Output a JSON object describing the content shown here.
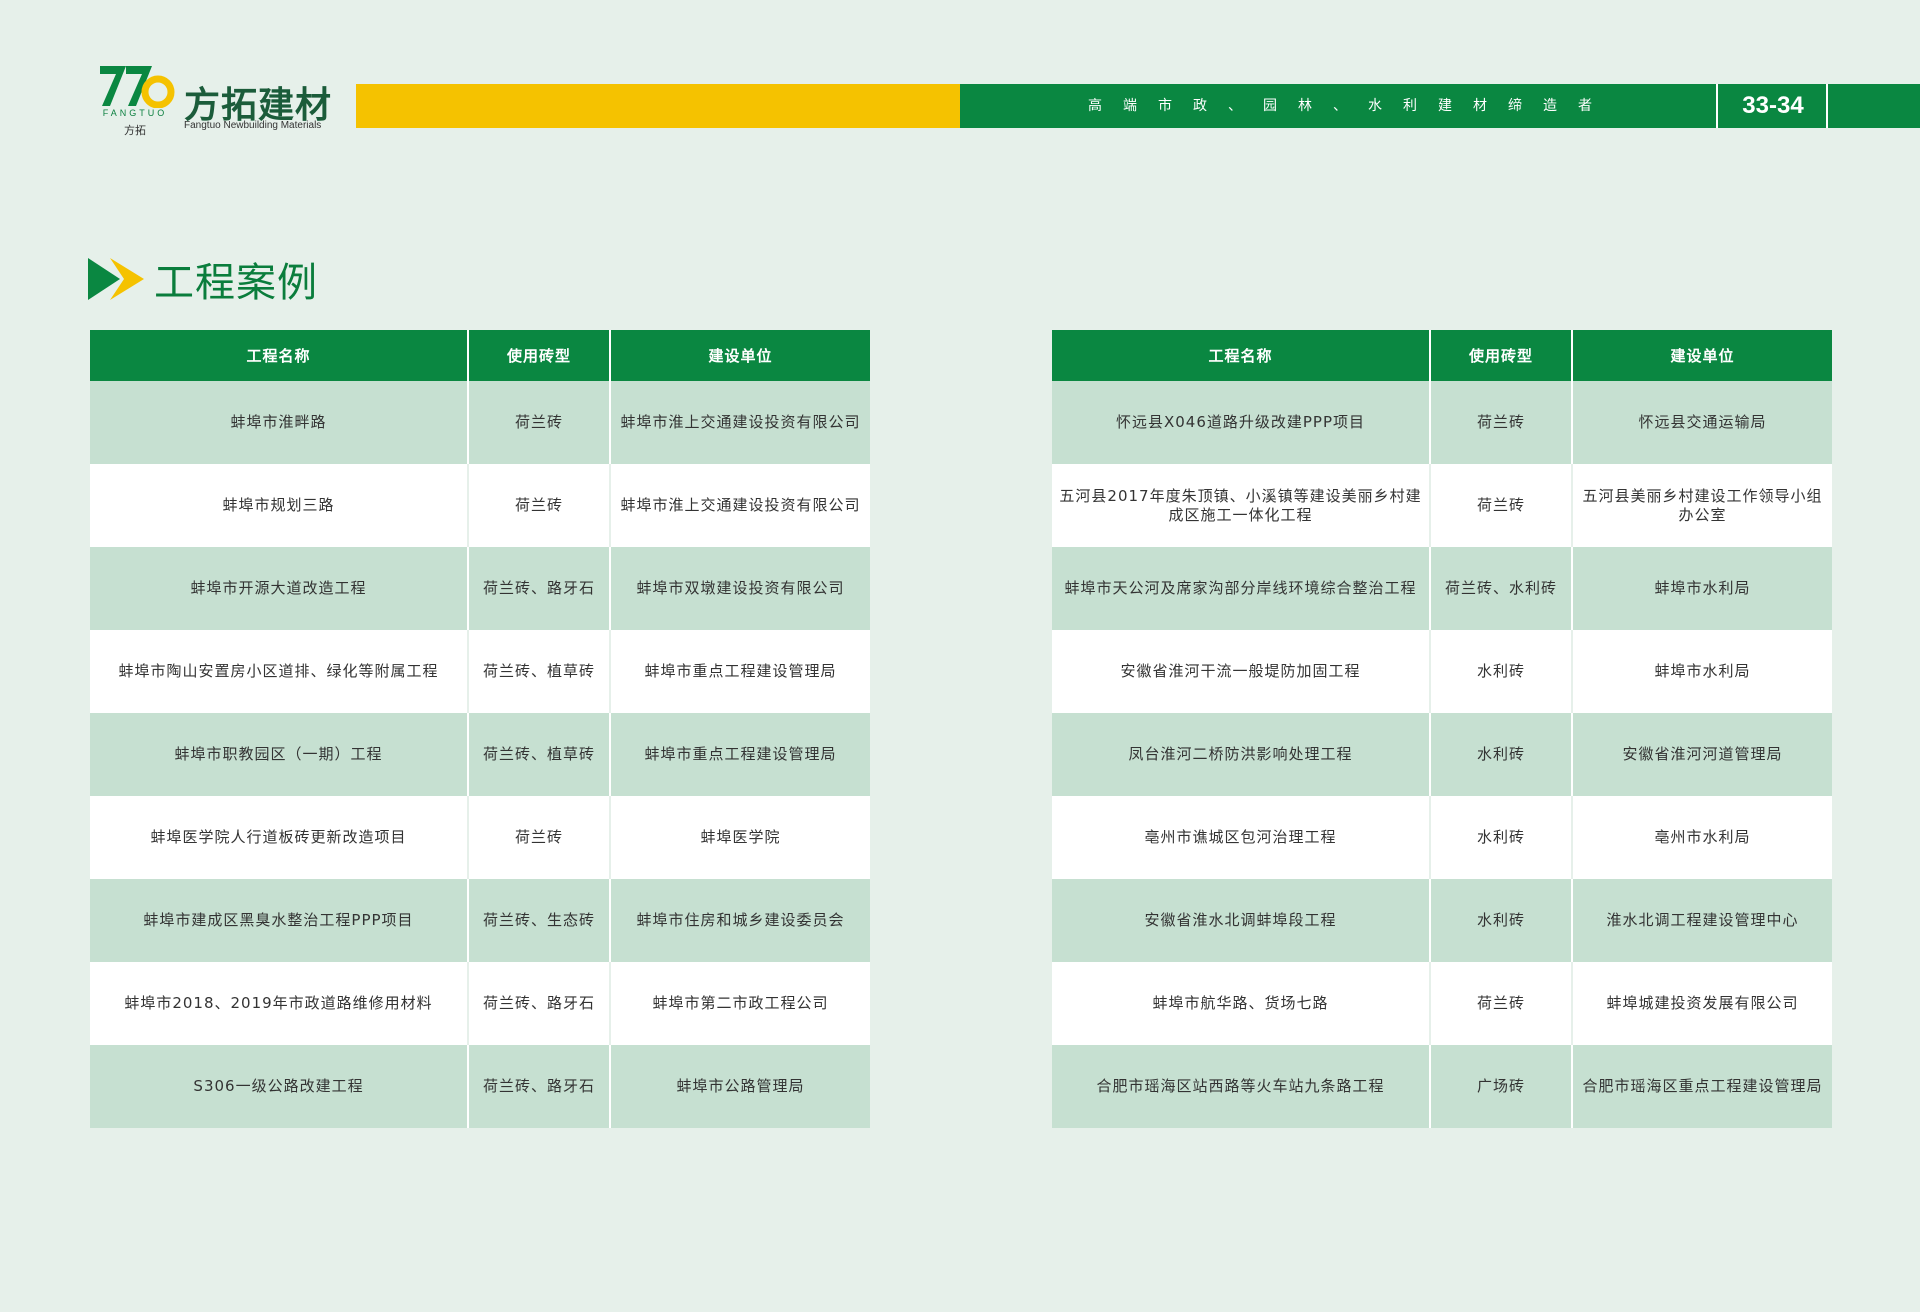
{
  "brand": {
    "mark_sub": "FANGTUO",
    "mark_cn": "方拓",
    "name_cn": "方拓建材",
    "name_en": "Fangtuo Newbuilding Materials"
  },
  "header": {
    "slogan": "高端市政、园林、水利建材缔造者",
    "page_number": "33-34"
  },
  "section": {
    "title": "工程案例"
  },
  "colors": {
    "green": "#0a8741",
    "yellow": "#f5c200",
    "row_tint": "#c6e0d1"
  },
  "table_left": {
    "headers": [
      "工程名称",
      "使用砖型",
      "建设单位"
    ],
    "rows": [
      [
        "蚌埠市淮畔路",
        "荷兰砖",
        "蚌埠市淮上交通建设投资有限公司"
      ],
      [
        "蚌埠市规划三路",
        "荷兰砖",
        "蚌埠市淮上交通建设投资有限公司"
      ],
      [
        "蚌埠市开源大道改造工程",
        "荷兰砖、路牙石",
        "蚌埠市双墩建设投资有限公司"
      ],
      [
        "蚌埠市陶山安置房小区道排、绿化等附属工程",
        "荷兰砖、植草砖",
        "蚌埠市重点工程建设管理局"
      ],
      [
        "蚌埠市职教园区（一期）工程",
        "荷兰砖、植草砖",
        "蚌埠市重点工程建设管理局"
      ],
      [
        "蚌埠医学院人行道板砖更新改造项目",
        "荷兰砖",
        "蚌埠医学院"
      ],
      [
        "蚌埠市建成区黑臭水整治工程PPP项目",
        "荷兰砖、生态砖",
        "蚌埠市住房和城乡建设委员会"
      ],
      [
        "蚌埠市2018、2019年市政道路维修用材料",
        "荷兰砖、路牙石",
        "蚌埠市第二市政工程公司"
      ],
      [
        "S306一级公路改建工程",
        "荷兰砖、路牙石",
        "蚌埠市公路管理局"
      ]
    ]
  },
  "table_right": {
    "headers": [
      "工程名称",
      "使用砖型",
      "建设单位"
    ],
    "rows": [
      [
        "怀远县X046道路升级改建PPP项目",
        "荷兰砖",
        "怀远县交通运输局"
      ],
      [
        "五河县2017年度朱顶镇、小溪镇等建设美丽乡村建成区施工一体化工程",
        "荷兰砖",
        "五河县美丽乡村建设工作领导小组办公室"
      ],
      [
        "蚌埠市天公河及席家沟部分岸线环境综合整治工程",
        "荷兰砖、水利砖",
        "蚌埠市水利局"
      ],
      [
        "安徽省淮河干流一般堤防加固工程",
        "水利砖",
        "蚌埠市水利局"
      ],
      [
        "凤台淮河二桥防洪影响处理工程",
        "水利砖",
        "安徽省淮河河道管理局"
      ],
      [
        "亳州市谯城区包河治理工程",
        "水利砖",
        "亳州市水利局"
      ],
      [
        "安徽省淮水北调蚌埠段工程",
        "水利砖",
        "淮水北调工程建设管理中心"
      ],
      [
        "蚌埠市航华路、货场七路",
        "荷兰砖",
        "蚌埠城建投资发展有限公司"
      ],
      [
        "合肥市瑶海区站西路等火车站九条路工程",
        "广场砖",
        "合肥市瑶海区重点工程建设管理局"
      ]
    ]
  }
}
